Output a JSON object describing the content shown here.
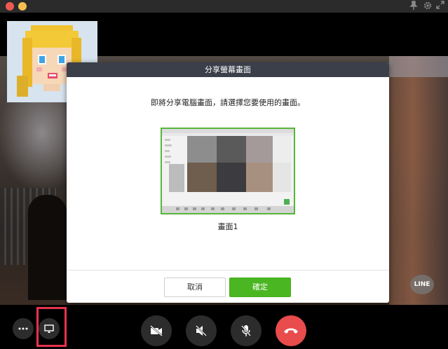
{
  "window": {
    "controls": [
      "close",
      "minimize"
    ],
    "right_icons": [
      "pin-icon",
      "gear-icon",
      "expand-icon"
    ]
  },
  "watermark": {
    "text": "LINE"
  },
  "dialog": {
    "title": "分享螢幕畫面",
    "message": "即將分享電腦畫面，請選擇您要使用的畫面。",
    "screen_option_label": "畫面1",
    "cancel_label": "取消",
    "confirm_label": "確定"
  },
  "toolbar": {
    "buttons": [
      "more-icon",
      "screen-share-icon",
      "video-off-icon",
      "speaker-mute-icon",
      "mic-mute-icon",
      "end-call-icon"
    ],
    "highlighted": "screen-share-icon"
  },
  "colors": {
    "dialog_header": "#3b3f4a",
    "confirm_green": "#4ab621",
    "end_call_red": "#e84c4c",
    "highlight_red": "#e5334d",
    "selection_border": "#56b63a"
  }
}
